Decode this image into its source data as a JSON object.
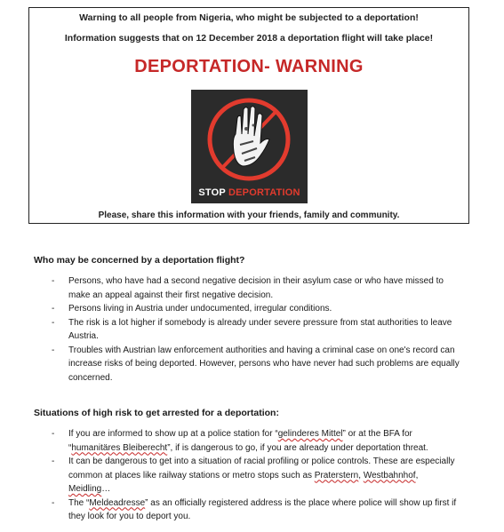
{
  "notice": {
    "line1": "Warning to all people from Nigeria, who might be subjected to a deportation!",
    "line2": "Information suggests that on 12 December 2018 a deportation flight will take place!",
    "headline": "DEPORTATION- WARNING",
    "poster": {
      "word1": "STOP",
      "word2": "DEPORTATION",
      "accent_color": "#e23b2e",
      "icon": "raised-hand-icon"
    },
    "share": "Please, share this information with your friends, family and community."
  },
  "section1": {
    "heading": "Who may be concerned by a deportation flight?",
    "items": [
      "Persons, who have had a second negative decision in their asylum case or who have missed to make an appeal against their first negative decision.",
      "Persons living in Austria under undocumented, irregular conditions.",
      "The risk is a lot higher if somebody is already under severe pressure from stat authorities to leave Austria.",
      "Troubles with Austrian law enforcement authorities and having a criminal case on one's record can increase risks of being deported. However, persons who have never had such problems are equally concerned."
    ]
  },
  "section2": {
    "heading": "Situations of high risk to get arrested for a deportation:",
    "item1": {
      "a": "If you are informed to show up at a police station for “",
      "b": "gelinderes Mittel",
      "c": "” or at the BFA for “",
      "d": "humanitäres Bleiberecht",
      "e": "”, if is dangerous to go, if you are already under deportation threat."
    },
    "item2": {
      "a": "It can be dangerous to get into a situation of racial profiling or police controls. These are especially common at places like railway stations or metro stops such as ",
      "b": "Praterstern",
      "c": ", ",
      "d": "Westbahnhof",
      "e": ", ",
      "f": "Meidling",
      "g": "…"
    },
    "item3": {
      "a": "The “",
      "b": "Meldeadresse",
      "c": "” as an officially registered address is the place where police will show up first if they look for you to deport you."
    }
  }
}
